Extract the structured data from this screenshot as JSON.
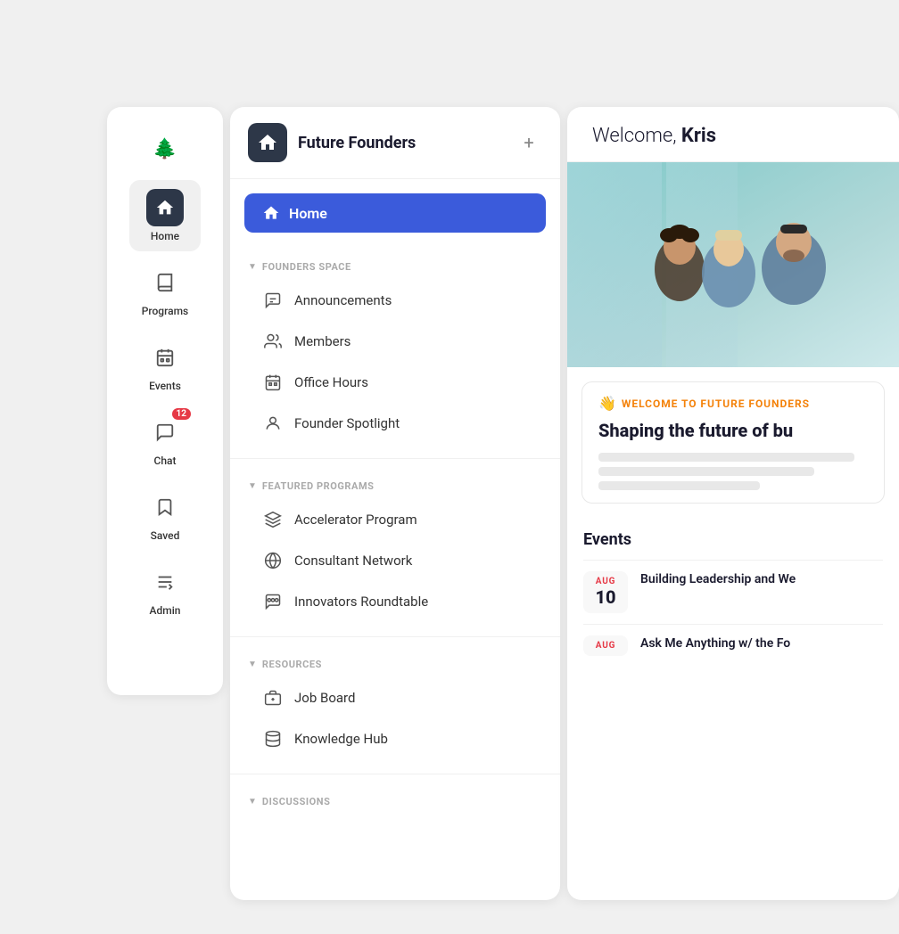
{
  "app": {
    "title": "Future Founders"
  },
  "icon_sidebar": {
    "items": [
      {
        "id": "logo",
        "label": "",
        "icon": "logo",
        "active": false
      },
      {
        "id": "home",
        "label": "Home",
        "icon": "home",
        "active": true
      },
      {
        "id": "programs",
        "label": "Programs",
        "icon": "programs",
        "active": false
      },
      {
        "id": "events",
        "label": "Events",
        "icon": "events",
        "active": false
      },
      {
        "id": "chat",
        "label": "Chat",
        "icon": "chat",
        "active": false,
        "badge": "12"
      },
      {
        "id": "saved",
        "label": "Saved",
        "icon": "saved",
        "active": false
      },
      {
        "id": "admin",
        "label": "Admin",
        "icon": "admin",
        "active": false
      }
    ]
  },
  "nav_sidebar": {
    "title": "Future Founders",
    "add_button_label": "+",
    "home_label": "Home",
    "sections": [
      {
        "id": "founders-space",
        "title": "FOUNDERS SPACE",
        "items": [
          {
            "id": "announcements",
            "label": "Announcements",
            "icon": "announcements"
          },
          {
            "id": "members",
            "label": "Members",
            "icon": "members"
          },
          {
            "id": "office-hours",
            "label": "Office Hours",
            "icon": "office-hours"
          },
          {
            "id": "founder-spotlight",
            "label": "Founder Spotlight",
            "icon": "founder-spotlight"
          }
        ]
      },
      {
        "id": "featured-programs",
        "title": "FEATURED PROGRAMS",
        "items": [
          {
            "id": "accelerator",
            "label": "Accelerator Program",
            "icon": "accelerator"
          },
          {
            "id": "consultant",
            "label": "Consultant Network",
            "icon": "consultant"
          },
          {
            "id": "innovators",
            "label": "Innovators Roundtable",
            "icon": "innovators"
          }
        ]
      },
      {
        "id": "resources",
        "title": "RESOURCES",
        "items": [
          {
            "id": "job-board",
            "label": "Job Board",
            "icon": "job-board"
          },
          {
            "id": "knowledge-hub",
            "label": "Knowledge Hub",
            "icon": "knowledge-hub"
          }
        ]
      },
      {
        "id": "discussions",
        "title": "DISCUSSIONS",
        "items": []
      }
    ]
  },
  "main": {
    "welcome_prefix": "Welcome, ",
    "welcome_name": "Kris",
    "card": {
      "tag_emoji": "👋",
      "tag_text": "WELCOME TO FUTURE FOUNDERS",
      "title": "Shaping the future of bu"
    },
    "events_section_title": "Events",
    "events": [
      {
        "id": "event-1",
        "month": "AUG",
        "day": "10",
        "title": "Building Leadership and We"
      },
      {
        "id": "event-2",
        "month": "AUG",
        "day": "",
        "title": "Ask Me Anything w/ the Fo"
      }
    ]
  },
  "colors": {
    "accent_blue": "#3b5bdb",
    "accent_red": "#e63946",
    "accent_orange": "#f4820a",
    "text_dark": "#1a1a2e",
    "text_muted": "#aaa",
    "bg_light": "#f0f0f0",
    "white": "#ffffff"
  }
}
